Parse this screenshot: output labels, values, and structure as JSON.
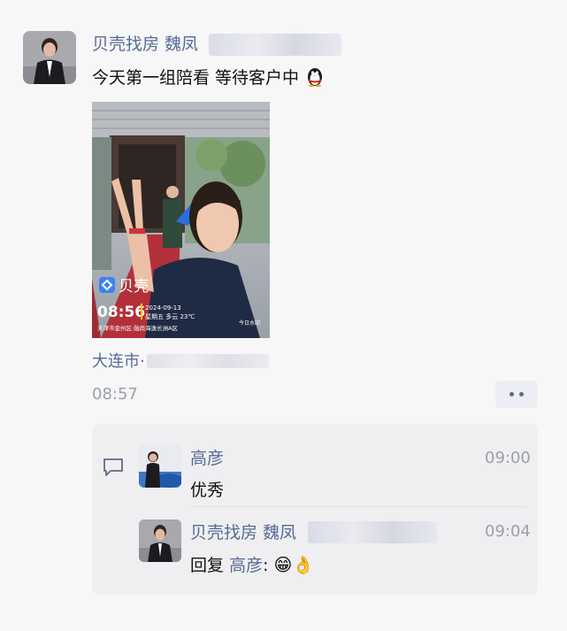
{
  "post": {
    "author": "贝壳找房 魏凤",
    "text": "今天第一组陪看 等待客户中",
    "emoji": "penguin-emoji",
    "location": "大连市·",
    "time": "08:57"
  },
  "photo": {
    "brand": "贝壳",
    "clock": "08:56",
    "date": "2024-09-13",
    "weather": "星期五 多云 23℃",
    "address": "天津市金州区·融尚海逸长洲A区",
    "stamp": "今日水印"
  },
  "comments": [
    {
      "author": "高彦",
      "time": "09:00",
      "text": "优秀"
    },
    {
      "author": "贝壳找房 魏凤",
      "time": "09:04",
      "reply_prefix": "回复",
      "reply_to": "高彦",
      "colon": ":",
      "emojis": "😁👌"
    }
  ],
  "colors": {
    "link": "#576b95",
    "text": "#111111",
    "muted": "#9aa0a9",
    "panel": "#efeff1"
  }
}
